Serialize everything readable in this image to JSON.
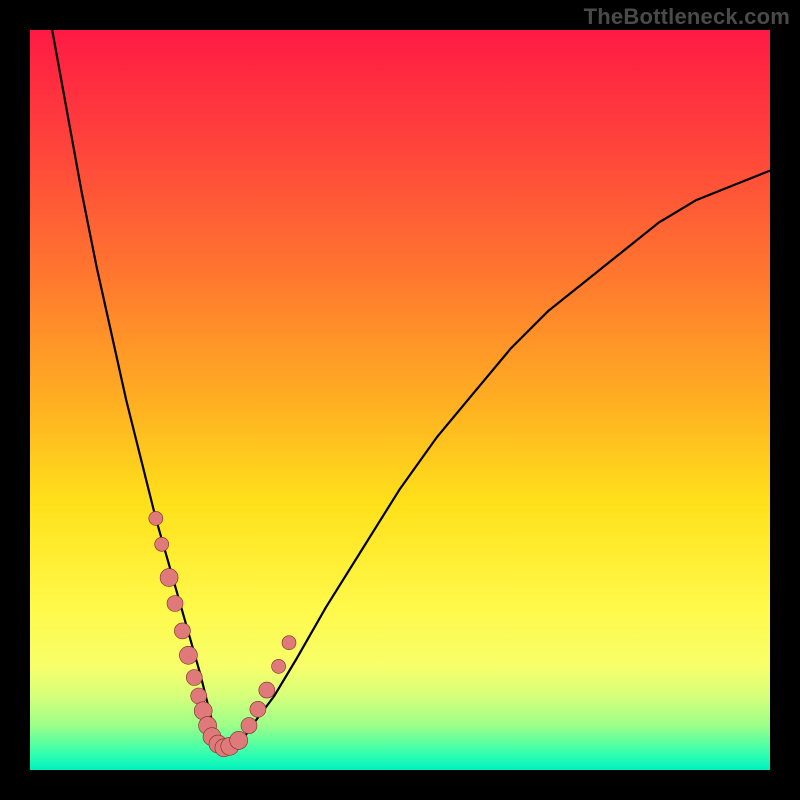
{
  "watermark": "TheBottleneck.com",
  "colors": {
    "frame": "#000000",
    "gradient_top": "#ff1a44",
    "gradient_bottom": "#00f0c0",
    "curve": "#000000",
    "marker_fill": "#e07a7a",
    "marker_stroke": "#7a2a2a"
  },
  "chart_data": {
    "type": "line",
    "title": "",
    "xlabel": "",
    "ylabel": "",
    "xlim": [
      0,
      100
    ],
    "ylim": [
      0,
      100
    ],
    "series": [
      {
        "name": "bottleneck-curve",
        "x": [
          3,
          5,
          7,
          9,
          11,
          13,
          15,
          17,
          19,
          21,
          23,
          24,
          25,
          26,
          28,
          30,
          33,
          36,
          40,
          45,
          50,
          55,
          60,
          65,
          70,
          75,
          80,
          85,
          90,
          95,
          100
        ],
        "y": [
          100,
          89,
          78,
          68,
          59,
          50,
          42,
          34,
          27,
          20,
          13,
          9,
          5,
          3,
          3,
          6,
          10,
          15,
          22,
          30,
          38,
          45,
          51,
          57,
          62,
          66,
          70,
          74,
          77,
          79,
          81
        ]
      }
    ],
    "markers": {
      "name": "highlight-points",
      "x": [
        17.0,
        17.8,
        18.8,
        19.6,
        20.6,
        21.4,
        22.2,
        22.8,
        23.4,
        24.0,
        24.6,
        25.4,
        26.2,
        27.0,
        28.2,
        29.6,
        30.8,
        32.0,
        33.6,
        35.0
      ],
      "y": [
        34.0,
        30.5,
        26.0,
        22.5,
        18.8,
        15.5,
        12.5,
        10.0,
        8.0,
        6.0,
        4.5,
        3.5,
        3.0,
        3.2,
        4.0,
        6.0,
        8.2,
        10.8,
        14.0,
        17.2
      ],
      "r": [
        7,
        7,
        9,
        8,
        8,
        9,
        8,
        8,
        9,
        9,
        9,
        9,
        9,
        9,
        9,
        8,
        8,
        8,
        7,
        7
      ]
    }
  }
}
